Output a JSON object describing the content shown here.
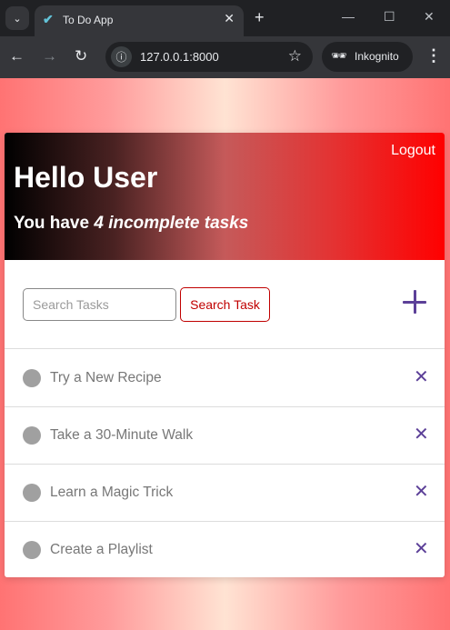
{
  "browser": {
    "tab_dropdown_icon": "chevron-down-icon",
    "tab_title": "To Do App",
    "tab_favicon": "✔",
    "url": "127.0.0.1:8000",
    "incognito_label": "Inkognito"
  },
  "header": {
    "logout_label": "Logout",
    "greeting": "Hello User",
    "subtitle_prefix": "You have ",
    "subtitle_highlight": "4 incomplete tasks"
  },
  "search": {
    "placeholder": "Search Tasks",
    "value": "",
    "button_label": "Search Task"
  },
  "tasks": [
    {
      "label": "Try a New Recipe"
    },
    {
      "label": "Take a 30-Minute Walk"
    },
    {
      "label": "Learn a Magic Trick"
    },
    {
      "label": "Create a Playlist"
    }
  ],
  "colors": {
    "accent": "#5c4098",
    "search_button": "#c00000",
    "task_check": "#a0a0a0"
  }
}
